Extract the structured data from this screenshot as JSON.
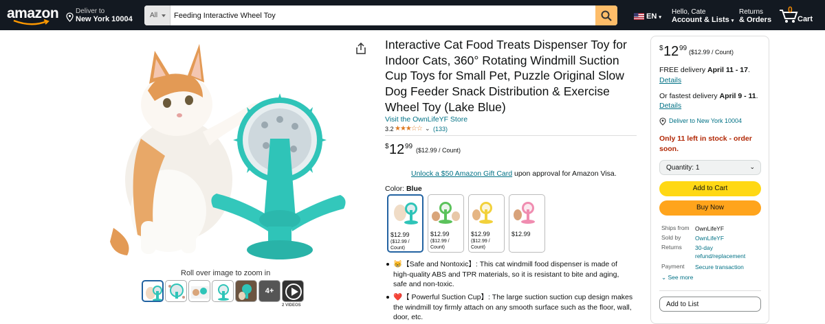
{
  "header": {
    "logo_text": "amazon",
    "deliver_to_label": "Deliver to",
    "deliver_to_location": "New York 10004",
    "search_category": "All",
    "search_query": "Feeding Interactive Wheel Toy",
    "language": "EN",
    "account_greeting": "Hello, Cate",
    "account_label": "Account & Lists",
    "returns_label": "Returns",
    "orders_label": "& Orders",
    "cart_count": "0",
    "cart_label": "Cart"
  },
  "gallery": {
    "zoom_hint": "Roll over image to zoom in",
    "more_count": "4+",
    "videos_label": "2 VIDEOS"
  },
  "product": {
    "title": "Interactive Cat Food Treats Dispenser Toy for Indoor Cats, 360° Rotating Windmill Suction Cup Toys for Small Pet, Puzzle Original Slow Dog Feeder Snack Distribution & Exercise Wheel Toy (Lake Blue)",
    "store_link": "Visit the OwnLifeYF Store",
    "rating": "3.2",
    "stars": "★★★☆☆",
    "rating_count": "(133)",
    "price_symbol": "$",
    "price_whole": "12",
    "price_fraction": "99",
    "price_per": "($12.99 / Count)",
    "giftcard_link": "Unlock a $50 Amazon Gift Card",
    "giftcard_rest": "upon approval for Amazon Visa.",
    "color_label": "Color:",
    "color_value": "Blue",
    "swatches": [
      {
        "price": "$12.99",
        "per": "($12.99 / Count)"
      },
      {
        "price": "$12.99",
        "per": "($12.99 / Count)"
      },
      {
        "price": "$12.99",
        "per": "($12.99 / Count)"
      },
      {
        "price": "$12.99",
        "per": ""
      }
    ],
    "bullets": [
      "😸【Safe and Nontoxic】: This cat windmill food dispenser is made of high-quality ABS and TPR materials, so it is resistant to bite and aging, safe and non-toxic.",
      "❤️【 Powerful Suction Cup】: The large suction suction cup design makes the windmill toy firmly attach on any smooth surface such as the floor, wall, door, etc."
    ]
  },
  "buybox": {
    "price_symbol": "$",
    "price_whole": "12",
    "price_fraction": "99",
    "price_per": "($12.99 / Count)",
    "free_delivery_prefix": "FREE delivery ",
    "free_delivery_date": "April 11 - 17",
    "free_delivery_suffix": ".",
    "details_label": "Details",
    "fastest_prefix": "Or fastest delivery ",
    "fastest_date": "April 9 - 11",
    "fastest_suffix": ".",
    "deliver_to": "Deliver to New York 10004",
    "stock": "Only 11 left in stock - order soon.",
    "quantity_label": "Quantity:",
    "quantity_value": "1",
    "add_to_cart": "Add to Cart",
    "buy_now": "Buy Now",
    "ships_from_label": "Ships from",
    "ships_from_value": "OwnLifeYF",
    "sold_by_label": "Sold by",
    "sold_by_value": "OwnLifeYF",
    "returns_label": "Returns",
    "returns_value": "30-day refund/replacement",
    "payment_label": "Payment",
    "payment_value": "Secure transaction",
    "see_more": "See more",
    "add_to_list": "Add to List"
  },
  "colors": {
    "header_bg": "#131921",
    "search_button": "#febd69",
    "add_to_cart": "#ffd814",
    "buy_now": "#ffa41c",
    "link": "#007185",
    "stock_red": "#b12704",
    "toy_teal": "#2fc4b8"
  }
}
